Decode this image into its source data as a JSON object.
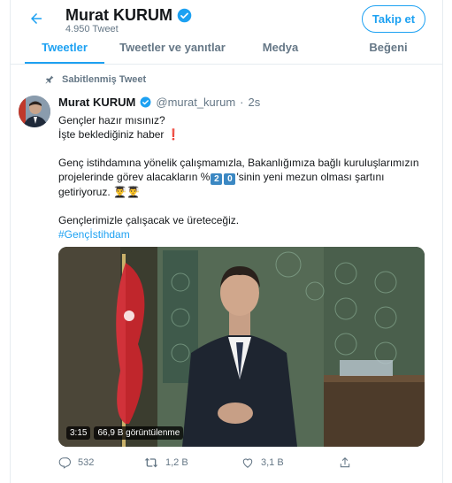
{
  "header": {
    "name": "Murat KURUM",
    "tweet_count": "4.950 Tweet",
    "follow_label": "Takip et"
  },
  "tabs": [
    {
      "label": "Tweetler",
      "active": true
    },
    {
      "label": "Tweetler ve yanıtlar",
      "active": false
    },
    {
      "label": "Medya",
      "active": false
    },
    {
      "label": "Beğeni",
      "active": false
    }
  ],
  "tweet": {
    "pinned_label": "Sabitlenmiş Tweet",
    "name": "Murat KURUM",
    "handle": "@murat_kurum",
    "separator": "·",
    "time": "2s",
    "line1": "Gençler hazır mısınız?",
    "line2": "İşte beklediğiniz haber",
    "line2_emoji": "❗",
    "para2_a": "Genç istihdamına yönelik çalışmamızla, Bakanlığımıza bağlı kuruluşlarımızın projelerinde görev alacakların %",
    "para2_digit1": "2",
    "para2_digit2": "0",
    "para2_b": "'sinin yeni mezun olması şartını getiriyoruz.",
    "para2_emoji": "👨‍🎓👨‍🎓",
    "para3": "Gençlerimizle çalışacak ve üreteceğiz.",
    "hashtag": "#Gençİstihdam",
    "video": {
      "duration": "3:15",
      "views": "66,9 B görüntülenme"
    },
    "actions": {
      "replies": "532",
      "retweets": "1,2 B",
      "likes": "3,1 B"
    }
  },
  "colors": {
    "accent": "#1da1f2",
    "text": "#14171a",
    "muted": "#657786"
  }
}
